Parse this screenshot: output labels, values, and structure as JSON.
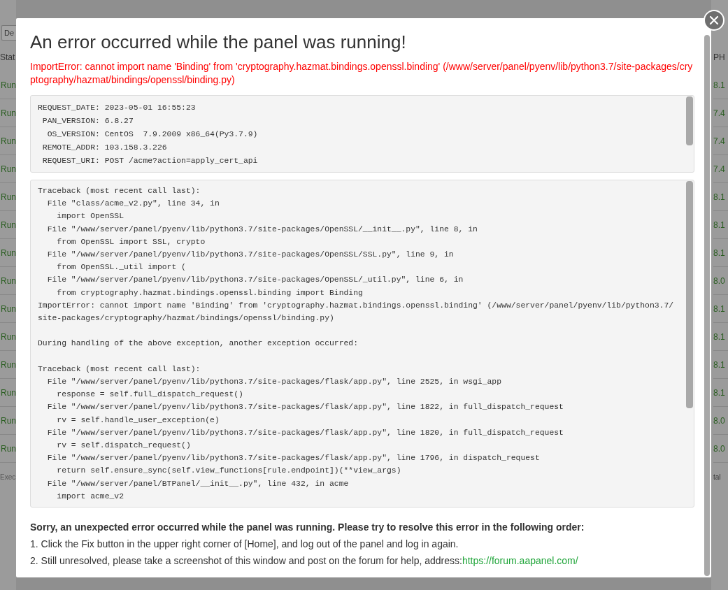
{
  "background": {
    "left_column": {
      "header_button": "De",
      "header": "Stat",
      "cells": [
        "Run",
        "Run",
        "Run",
        "Run",
        "Run",
        "Run",
        "Run",
        "Run",
        "Run",
        "Run",
        "Run",
        "Run",
        "Run",
        "Run"
      ],
      "footer": "Exec"
    },
    "right_column": {
      "header": "PH",
      "cells": [
        "8.1",
        "7.4",
        "7.4",
        "7.4",
        "8.1",
        "8.1",
        "8.1",
        "8.0",
        "8.1",
        "8.1",
        "8.1",
        "8.1",
        "8.0",
        "8.0"
      ],
      "footer": "tal"
    }
  },
  "dialog": {
    "title": "An error occurred while the panel was running!",
    "error": "ImportError: cannot import name 'Binding' from 'cryptography.hazmat.bindings.openssl.binding' (/www/server/panel/pyenv/lib/python3.7/site-packages/cryptography/hazmat/bindings/openssl/binding.py)",
    "environment": [
      "REQUEST_DATE: 2023-05-01 16:55:23",
      " PAN_VERSION: 6.8.27",
      "  OS_VERSION: CentOS  7.9.2009 x86_64(Py3.7.9)",
      " REMOTE_ADDR: 103.158.3.226",
      " REQUEST_URI: POST /acme?action=apply_cert_api"
    ],
    "traceback": [
      [
        "Traceback (most recent call last):",
        "  File \"class/acme_v2.py\", line 34, in",
        "    import OpenSSL",
        "  File \"/www/server/panel/pyenv/lib/python3.7/site-packages/OpenSSL/__init__.py\", line 8, in",
        "    from OpenSSL import SSL, crypto",
        "  File \"/www/server/panel/pyenv/lib/python3.7/site-packages/OpenSSL/SSL.py\", line 9, in",
        "    from OpenSSL._util import (",
        "  File \"/www/server/panel/pyenv/lib/python3.7/site-packages/OpenSSL/_util.py\", line 6, in",
        "    from cryptography.hazmat.bindings.openssl.binding import Binding",
        "ImportError: cannot import name 'Binding' from 'cryptography.hazmat.bindings.openssl.binding' (/www/server/panel/pyenv/lib/python3.7/site-packages/cryptography/hazmat/bindings/openssl/binding.py)"
      ],
      [
        "During handling of the above exception, another exception occurred:"
      ],
      [
        "Traceback (most recent call last):",
        "  File \"/www/server/panel/pyenv/lib/python3.7/site-packages/flask/app.py\", line 2525, in wsgi_app",
        "    response = self.full_dispatch_request()",
        "  File \"/www/server/panel/pyenv/lib/python3.7/site-packages/flask/app.py\", line 1822, in full_dispatch_request",
        "    rv = self.handle_user_exception(e)",
        "  File \"/www/server/panel/pyenv/lib/python3.7/site-packages/flask/app.py\", line 1820, in full_dispatch_request",
        "    rv = self.dispatch_request()",
        "  File \"/www/server/panel/pyenv/lib/python3.7/site-packages/flask/app.py\", line 1796, in dispatch_request",
        "    return self.ensure_sync(self.view_functions[rule.endpoint])(**view_args)",
        "  File \"/www/server/panel/BTPanel/__init__.py\", line 432, in acme",
        "    import acme_v2"
      ]
    ],
    "help": {
      "heading": "Sorry, an unexpected error occurred while the panel was running. Please try to resolve this error in the following order:",
      "steps": [
        {
          "text": "1. Click the Fix button in the upper right corner of [Home], and log out of the panel and log in again."
        },
        {
          "text": "2. Still unresolved, please take a screenshot of this window and post on the forum for help, address:",
          "link": "https://forum.aapanel.com/"
        }
      ]
    }
  }
}
